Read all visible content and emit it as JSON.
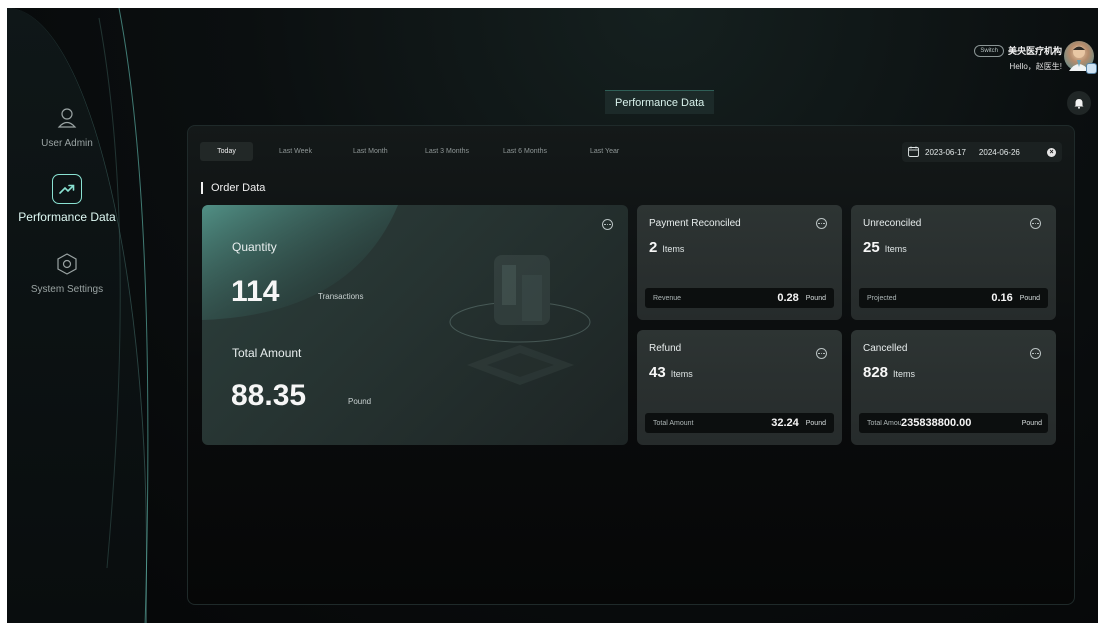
{
  "sidebar": {
    "items": [
      {
        "label": "User Admin",
        "icon": "user-icon",
        "active": false
      },
      {
        "label": "Performance Data",
        "icon": "trend-chart-icon",
        "active": true
      },
      {
        "label": "System Settings",
        "icon": "hexagon-settings-icon",
        "active": false
      }
    ]
  },
  "header": {
    "title": "Performance Data",
    "switch_label": "Switch",
    "org_name": "美央医疗机构",
    "greeting": "Hello，赵医生!"
  },
  "filters": {
    "tabs": [
      "Today",
      "Last Week",
      "Last Month",
      "Last 3 Months",
      "Last 6 Months",
      "Last Year"
    ],
    "active_tab": "Today",
    "date_start": "2023-06-17",
    "date_end": "2024-06-26"
  },
  "section": {
    "title": "Order Data"
  },
  "summary": {
    "quantity_label": "Quantity",
    "quantity_value": "114",
    "quantity_unit": "Transactions",
    "amount_label": "Total Amount",
    "amount_value": "88.35",
    "amount_unit": "Pound"
  },
  "cards": {
    "payment_reconciled": {
      "title": "Payment Reconciled",
      "count": "2",
      "count_unit": "Items",
      "foot_label": "Revenue",
      "foot_value": "0.28",
      "foot_unit": "Pound"
    },
    "unreconciled": {
      "title": "Unreconciled",
      "count": "25",
      "count_unit": "Items",
      "foot_label": "Projected",
      "foot_value": "0.16",
      "foot_unit": "Pound"
    },
    "refund": {
      "title": "Refund",
      "count": "43",
      "count_unit": "Items",
      "foot_label": "Total Amount",
      "foot_value": "32.24",
      "foot_unit": "Pound"
    },
    "cancelled": {
      "title": "Cancelled",
      "count": "828",
      "count_unit": "Items",
      "foot_label": "Total Amount",
      "foot_value": "235838800.00",
      "foot_unit": "Pound"
    }
  },
  "colors": {
    "accent": "#8ae2d2",
    "background": "#07090a",
    "card": "#2b3231"
  }
}
